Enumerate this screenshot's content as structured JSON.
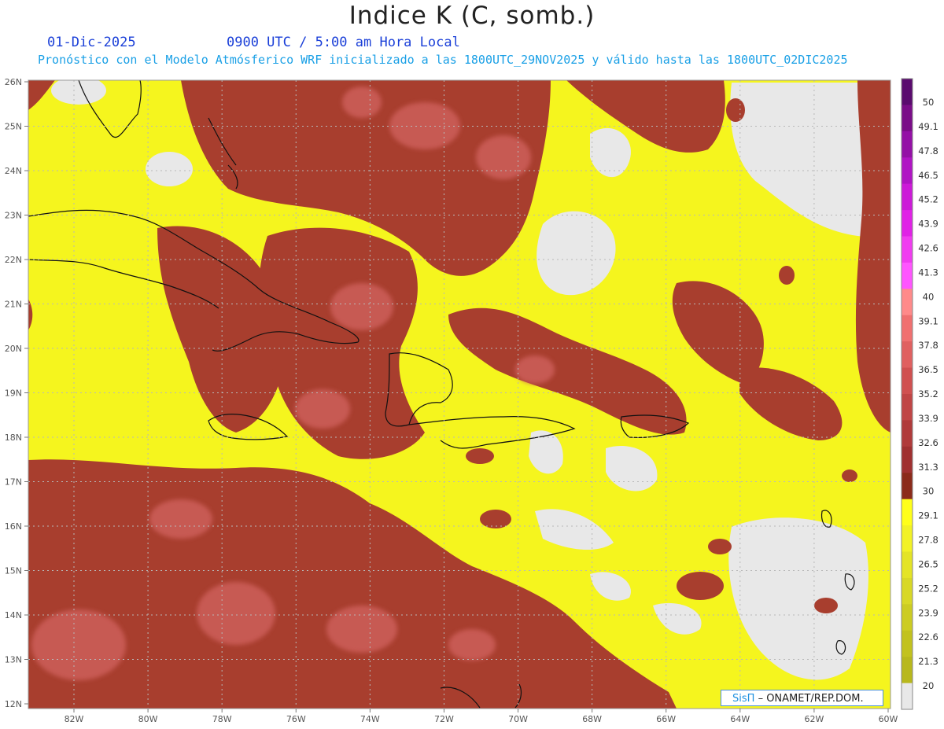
{
  "header": {
    "title": "Indice K (C, somb.)",
    "date": "01-Dic-2025",
    "time": "0900 UTC / 5:00 am Hora Local",
    "forecast": "Pronóstico con el Modelo Atmósferico WRF inicializado a las 1800UTC_29NOV2025 y válido hasta las  1800UTC_02DIC2025"
  },
  "axes": {
    "lat_labels": [
      "26N",
      "25N",
      "24N",
      "23N",
      "22N",
      "21N",
      "20N",
      "19N",
      "18N",
      "17N",
      "16N",
      "15N",
      "14N",
      "13N",
      "12N"
    ],
    "lon_labels": [
      "82W",
      "80W",
      "78W",
      "76W",
      "74W",
      "72W",
      "70W",
      "68W",
      "66W",
      "64W",
      "62W",
      "60W"
    ]
  },
  "colorbar": {
    "labels": [
      "50",
      "49.1",
      "47.8",
      "46.5",
      "45.2",
      "43.9",
      "42.6",
      "41.3",
      "40",
      "39.1",
      "37.8",
      "36.5",
      "35.2",
      "33.9",
      "32.6",
      "31.3",
      "30",
      "29.1",
      "27.8",
      "26.5",
      "25.2",
      "23.9",
      "22.6",
      "21.3",
      "20"
    ],
    "colors": [
      "#5a0a6e",
      "#7a0c88",
      "#9410a6",
      "#b014c4",
      "#cc1ad8",
      "#e022e6",
      "#f03cf0",
      "#ff55ff",
      "#ff8a8a",
      "#f07070",
      "#e06060",
      "#d05050",
      "#c04545",
      "#b03a3a",
      "#a03030",
      "#8b2a1a",
      "#ffff1a",
      "#f2f226",
      "#e4e426",
      "#d8d826",
      "#cccc22",
      "#c2c21e",
      "#b8b81c",
      "#e8e8e8"
    ]
  },
  "colors": {
    "low": "#e8e8e8",
    "mid": "#f5f51e",
    "high": "#a83e2e",
    "very_high": "#cd5e5a",
    "coast": "#111111"
  },
  "credit": {
    "brand": "SisΠ",
    "text": "– ONAMET/REP.DOM."
  }
}
